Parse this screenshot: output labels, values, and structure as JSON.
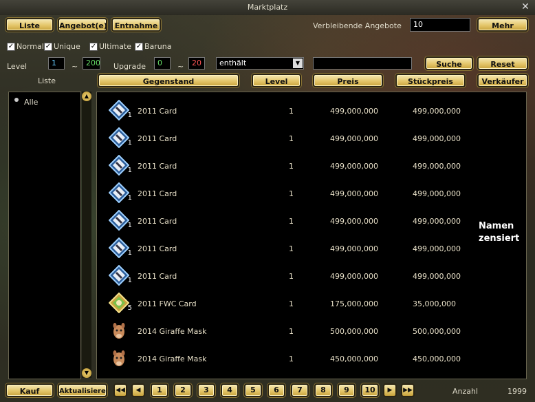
{
  "window": {
    "title": "Marktplatz"
  },
  "tabs": {
    "liste": "Liste",
    "angebot": "Angebot(e)",
    "entnahme": "Entnahme"
  },
  "offers": {
    "label": "Verbleibende Angebote",
    "value": "10",
    "mehr": "Mehr"
  },
  "filters": {
    "normal": "Normal",
    "unique": "Unique",
    "ultimate": "Ultimate",
    "baruna": "Baruna",
    "level_label": "Level",
    "level_min": "1",
    "level_max": "200",
    "tilde1": "~",
    "upgrade_label": "Upgrade",
    "upgrade_min": "0",
    "upgrade_max": "20",
    "tilde2": "~",
    "match_mode": "enthält",
    "search_value": "",
    "search": "Suche",
    "reset": "Reset"
  },
  "columns": {
    "liste": "Liste",
    "gegenstand": "Gegenstand",
    "level": "Level",
    "preis": "Preis",
    "stueckpreis": "Stückpreis",
    "verkaeufer": "Verkäufer"
  },
  "categories": [
    {
      "label": "Alle"
    }
  ],
  "censored_note": "Namen\nzensiert",
  "rows": [
    {
      "icon": "card-icon",
      "qty": "1",
      "name": "2011 Card",
      "level": "1",
      "price": "499,000,000",
      "unit": "499,000,000"
    },
    {
      "icon": "card-icon",
      "qty": "1",
      "name": "2011 Card",
      "level": "1",
      "price": "499,000,000",
      "unit": "499,000,000"
    },
    {
      "icon": "card-icon",
      "qty": "1",
      "name": "2011 Card",
      "level": "1",
      "price": "499,000,000",
      "unit": "499,000,000"
    },
    {
      "icon": "card-icon",
      "qty": "1",
      "name": "2011 Card",
      "level": "1",
      "price": "499,000,000",
      "unit": "499,000,000"
    },
    {
      "icon": "card-icon",
      "qty": "1",
      "name": "2011 Card",
      "level": "1",
      "price": "499,000,000",
      "unit": "499,000,000"
    },
    {
      "icon": "card-icon",
      "qty": "1",
      "name": "2011 Card",
      "level": "1",
      "price": "499,000,000",
      "unit": "499,000,000"
    },
    {
      "icon": "card-icon",
      "qty": "1",
      "name": "2011 Card",
      "level": "1",
      "price": "499,000,000",
      "unit": "499,000,000"
    },
    {
      "icon": "fwc-card-icon",
      "qty": "5",
      "name": "2011 FWC Card",
      "level": "1",
      "price": "175,000,000",
      "unit": "35,000,000"
    },
    {
      "icon": "giraffe-mask-icon",
      "qty": "",
      "name": "2014 Giraffe Mask",
      "level": "1",
      "price": "500,000,000",
      "unit": "500,000,000"
    },
    {
      "icon": "giraffe-mask-icon",
      "qty": "",
      "name": "2014 Giraffe Mask",
      "level": "1",
      "price": "450,000,000",
      "unit": "450,000,000"
    }
  ],
  "footer": {
    "kauf": "Kauf",
    "aktualisieren": "Aktualisieren",
    "pages": [
      "1",
      "2",
      "3",
      "4",
      "5",
      "6",
      "7",
      "8",
      "9",
      "10"
    ],
    "anzahl_label": "Anzahl",
    "anzahl_value": "1999"
  }
}
